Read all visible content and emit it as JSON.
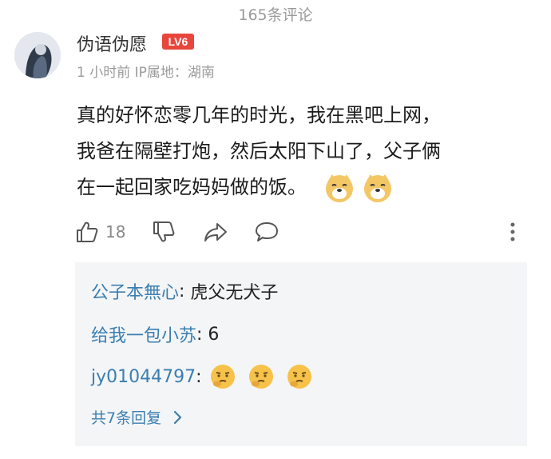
{
  "header": {
    "comment_count": "165条评论"
  },
  "comment": {
    "username": "伪语伪愿",
    "level": "LV6",
    "meta": "1 小时前 IP属地：湖南",
    "body_lines": [
      "真的好怀恋零几年的时光，我在黑吧上网，",
      "我爸在隔壁打炮，然后太阳下山了，父子俩",
      "在一起回家吃妈妈做的饭。"
    ],
    "emojis": [
      "doge-emoji",
      "doge-emoji"
    ]
  },
  "actions": {
    "like_count": "18"
  },
  "replies": [
    {
      "user": "公子本無心",
      "sep": ": ",
      "text": "虎父无犬子",
      "emojis": []
    },
    {
      "user": "给我一包小苏",
      "sep": ": ",
      "text": "6",
      "emojis": []
    },
    {
      "user": "jy01044797",
      "sep": ": ",
      "text": "",
      "emojis": [
        "thinking-emoji",
        "thinking-emoji",
        "thinking-emoji"
      ]
    }
  ],
  "more_replies": "共7条回复",
  "colors": {
    "link": "#3b7fb0",
    "level_badge": "#e8453c",
    "reply_bg": "#f4f5f7"
  }
}
